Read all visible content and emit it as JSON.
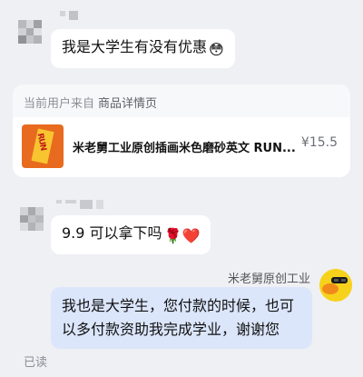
{
  "messages": {
    "first": {
      "text": "我是大学生有没有优惠",
      "emoji": "😳"
    },
    "second": {
      "text": "9.9 可以拿下吗",
      "emoji": "🌹❤️"
    },
    "reply": {
      "sender": "米老舅原创工业",
      "text": "我也是大学生，您付款的时候，也可以多付款资助我完成学业，谢谢您"
    }
  },
  "product_card": {
    "header_prefix": "当前用户来自",
    "header_source": "商品详情页",
    "title": "米老舅工业原创插画米色磨砂英文 RUN...",
    "price": "¥15.5",
    "thumb_text": "RUN"
  },
  "status": {
    "read": "已读"
  },
  "colors": {
    "reply_bubble": "#dbe6fb",
    "background": "#eef0f4",
    "accent_avatar": "#f7d21c"
  }
}
